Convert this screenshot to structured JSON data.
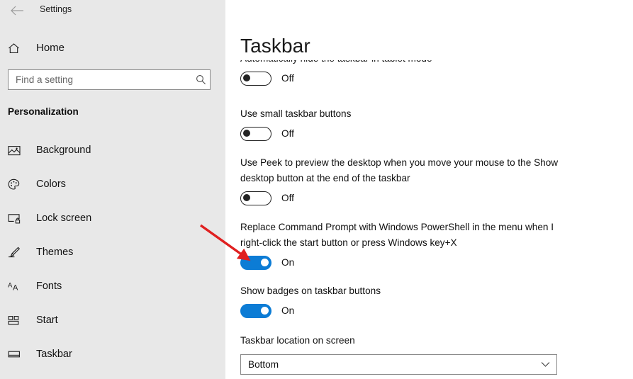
{
  "window": {
    "title": "Settings",
    "back_icon": "back-arrow-icon"
  },
  "sidebar": {
    "home": {
      "label": "Home",
      "icon": "home-icon"
    },
    "search": {
      "placeholder": "Find a setting",
      "value": "",
      "icon": "search-icon"
    },
    "section_heading": "Personalization",
    "items": [
      {
        "label": "Background",
        "icon": "picture-icon",
        "selected": false
      },
      {
        "label": "Colors",
        "icon": "palette-icon",
        "selected": false
      },
      {
        "label": "Lock screen",
        "icon": "lock-screen-icon",
        "selected": false
      },
      {
        "label": "Themes",
        "icon": "brush-icon",
        "selected": false
      },
      {
        "label": "Fonts",
        "icon": "font-aa-icon",
        "selected": false
      },
      {
        "label": "Start",
        "icon": "start-tiles-icon",
        "selected": false
      },
      {
        "label": "Taskbar",
        "icon": "taskbar-icon",
        "selected": false
      }
    ]
  },
  "main": {
    "page_title": "Taskbar",
    "settings": [
      {
        "label": "Automatically hide the taskbar in tablet mode",
        "control": "toggle",
        "state": "Off",
        "clipped": true
      },
      {
        "label": "Use small taskbar buttons",
        "control": "toggle",
        "state": "Off"
      },
      {
        "label": "Use Peek to preview the desktop when you move your mouse to the Show desktop button at the end of the taskbar",
        "control": "toggle",
        "state": "Off"
      },
      {
        "label": "Replace Command Prompt with Windows PowerShell in the menu when I right-click the start button or press Windows key+X",
        "control": "toggle",
        "state": "On",
        "highlighted": true
      },
      {
        "label": "Show badges on taskbar buttons",
        "control": "toggle",
        "state": "On"
      },
      {
        "label": "Taskbar location on screen",
        "control": "dropdown",
        "value": "Bottom"
      }
    ]
  },
  "annotation": {
    "type": "arrow",
    "color": "#e02020",
    "points_to": "powershell-toggle"
  },
  "colors": {
    "accent": "#0c7cd5",
    "sidebar_bg": "#e8e8e8",
    "content_bg": "#ffffff",
    "text": "#111111",
    "annotation_red": "#e02020"
  }
}
